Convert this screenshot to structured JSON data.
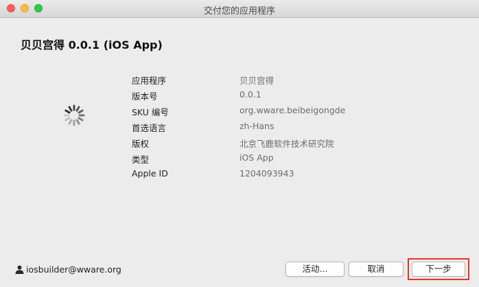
{
  "window": {
    "title": "交付您的应用程序"
  },
  "app_title": "贝贝宫得 0.0.1 (iOS App)",
  "info": [
    {
      "label": "应用程序",
      "value": "贝贝宫得"
    },
    {
      "label": "版本号",
      "value": "0.0.1"
    },
    {
      "label": "SKU 编号",
      "value": "org.wware.beibeigongde"
    },
    {
      "label": "首选语言",
      "value": "zh-Hans"
    },
    {
      "label": "版权",
      "value": "北京飞鹿软件技术研究院"
    },
    {
      "label": "类型",
      "value": "iOS App"
    },
    {
      "label": "Apple ID",
      "value": "1204093943"
    }
  ],
  "footer": {
    "user": "iosbuilder@wware.org",
    "buttons": {
      "activity": "活动...",
      "cancel": "取消",
      "next": "下一步"
    }
  },
  "icons": {
    "spinner": "loading-spinner-icon",
    "user": "person-icon"
  },
  "colors": {
    "close": "#fc605c",
    "minimize": "#fdbc40",
    "zoom": "#34c84a",
    "highlight": "#e8312c"
  }
}
